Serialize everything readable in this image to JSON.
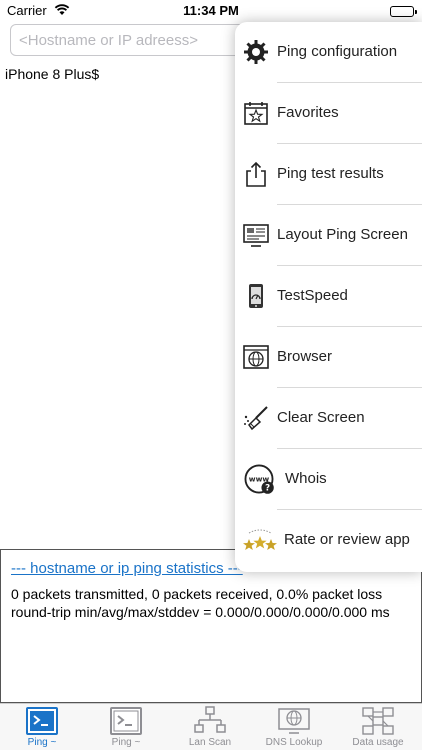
{
  "status_bar": {
    "carrier": "Carrier",
    "time": "11:34 PM"
  },
  "host_input": {
    "placeholder": "<Hostname or IP adreess>",
    "value": ""
  },
  "device_label": "iPhone 8 Plus$",
  "menu": {
    "items": [
      {
        "label": "Ping configuration",
        "icon": "gear-icon"
      },
      {
        "label": "Favorites",
        "icon": "favorites-calendar-icon"
      },
      {
        "label": "Ping test results",
        "icon": "share-icon"
      },
      {
        "label": "Layout Ping Screen",
        "icon": "layout-screen-icon"
      },
      {
        "label": "TestSpeed",
        "icon": "speedtest-phone-icon"
      },
      {
        "label": "Browser",
        "icon": "browser-globe-icon"
      },
      {
        "label": "Clear Screen",
        "icon": "broom-icon"
      },
      {
        "label": "Whois",
        "icon": "whois-icon"
      },
      {
        "label": "Rate or review app",
        "icon": "stars-icon"
      }
    ]
  },
  "output": {
    "stats_link": "--- hostname or ip ping statistics ---",
    "line1": "0 packets transmitted, 0 packets received, 0.0% packet loss",
    "line2": "round-trip min/avg/max/stddev = 0.000/0.000/0.000/0.000 ms"
  },
  "tabs": [
    {
      "label": "Ping ~",
      "icon": "terminal-icon",
      "active": true
    },
    {
      "label": "Ping ~",
      "icon": "terminal-icon",
      "active": false
    },
    {
      "label": "Lan Scan",
      "icon": "network-icon",
      "active": false
    },
    {
      "label": "DNS Lookup",
      "icon": "dns-icon",
      "active": false
    },
    {
      "label": "Data usage",
      "icon": "data-usage-icon",
      "active": false
    }
  ],
  "colors": {
    "accent": "#1a73c8",
    "inactive": "#8e8e93"
  }
}
